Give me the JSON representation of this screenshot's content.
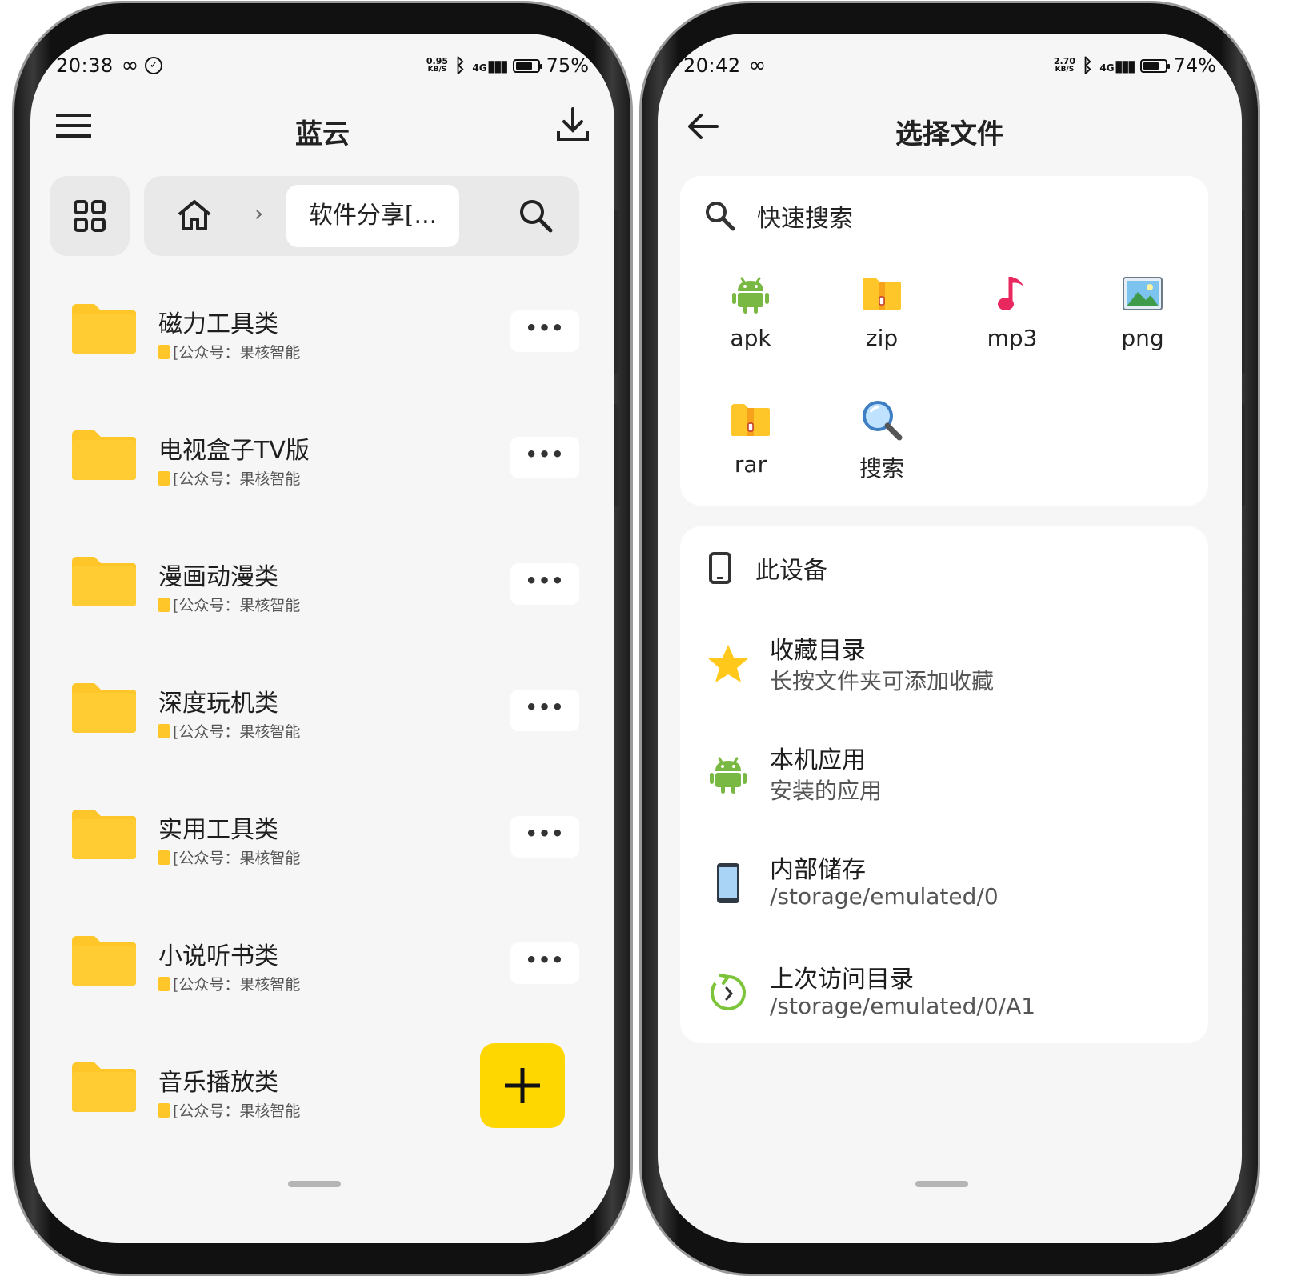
{
  "left": {
    "status": {
      "time": "20:38",
      "speed_top": "0.95",
      "speed_unit": "KB/S",
      "net": "4G",
      "battery": "75%",
      "battery_level": 0.75
    },
    "title": "蓝云",
    "icons": {
      "menu": "menu-icon",
      "download": "download-icon",
      "grid": "grid-icon",
      "home": "home-icon",
      "search": "search-icon"
    },
    "breadcrumb_current": "软件分享[...",
    "folders": [
      {
        "name": "磁力工具类",
        "sub": "[公众号：果核智能"
      },
      {
        "name": "电视盒子TV版",
        "sub": "[公众号：果核智能"
      },
      {
        "name": "漫画动漫类",
        "sub": "[公众号：果核智能"
      },
      {
        "name": "深度玩机类",
        "sub": "[公众号：果核智能"
      },
      {
        "name": "实用工具类",
        "sub": "[公众号：果核智能"
      },
      {
        "name": "小说听书类",
        "sub": "[公众号：果核智能"
      },
      {
        "name": "音乐播放类",
        "sub": "[公众号：果核智能"
      }
    ],
    "more_label": "•••",
    "colors": {
      "folder": "#ffc62a",
      "fab": "#ffd700"
    }
  },
  "right": {
    "status": {
      "time": "20:42",
      "speed_top": "2.70",
      "speed_unit": "KB/S",
      "net": "4G",
      "battery": "74%",
      "battery_level": 0.74
    },
    "title": "选择文件",
    "quick_search": "快速搜索",
    "file_types": [
      {
        "label": "apk",
        "icon": "android-icon"
      },
      {
        "label": "zip",
        "icon": "zip-folder-icon"
      },
      {
        "label": "mp3",
        "icon": "music-note-icon"
      },
      {
        "label": "png",
        "icon": "image-icon"
      },
      {
        "label": "rar",
        "icon": "rar-folder-icon"
      },
      {
        "label": "搜索",
        "icon": "magnifier-icon"
      }
    ],
    "device_header": "此设备",
    "entries": [
      {
        "title": "收藏目录",
        "sub": "长按文件夹可添加收藏",
        "icon": "star-icon"
      },
      {
        "title": "本机应用",
        "sub": "安装的应用",
        "icon": "android-icon"
      },
      {
        "title": "内部储存",
        "sub": "/storage/emulated/0",
        "icon": "phone-icon"
      },
      {
        "title": "上次访问目录",
        "sub": "/storage/emulated/0/A1",
        "icon": "history-icon"
      }
    ],
    "colors": {
      "android": "#78b843",
      "star": "#ffc81a",
      "music": "#e8285f",
      "history": "#7cc43a"
    }
  }
}
